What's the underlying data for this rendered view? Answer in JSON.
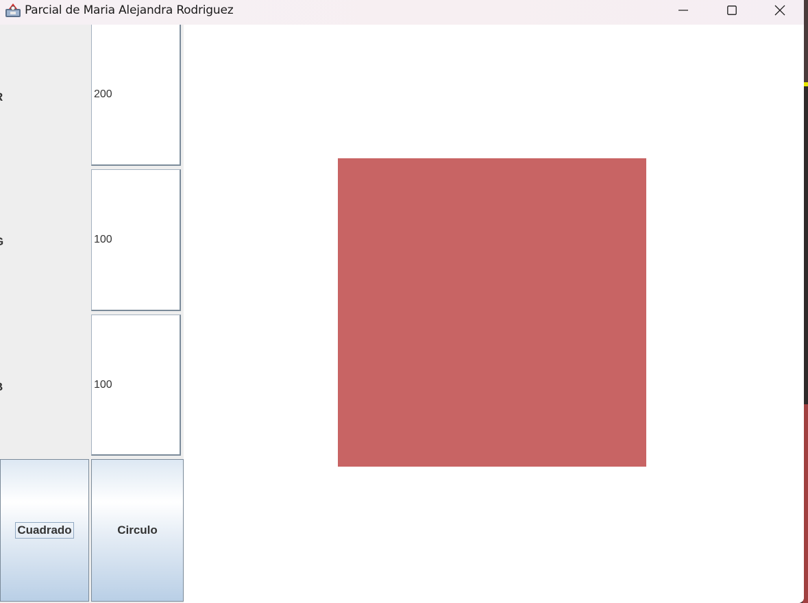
{
  "window": {
    "title": "Parcial de Maria Alejandra Rodriguez",
    "icon": "java-app-icon",
    "controls": {
      "minimize": "minimize-icon",
      "maximize": "maximize-icon",
      "close": "close-icon"
    }
  },
  "controls": {
    "r_label": "R",
    "r_value": "200",
    "g_label": "G",
    "g_value": "100",
    "b_label": "B",
    "b_value": "100",
    "square_button": "Cuadrado",
    "circle_button": "Circulo"
  },
  "canvas": {
    "shape": "square",
    "fill_color": "#c86464"
  }
}
